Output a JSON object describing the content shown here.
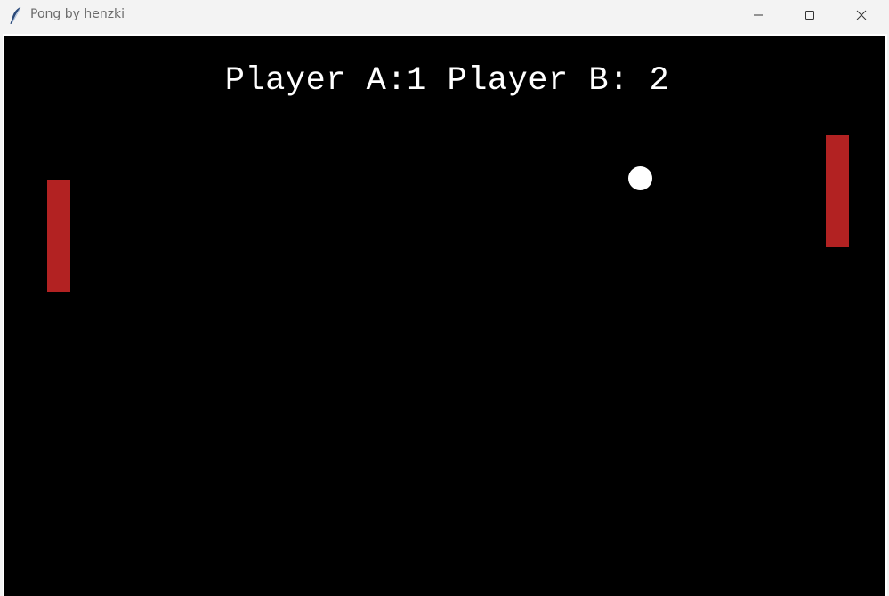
{
  "window": {
    "title": "Pong by henzki",
    "icon": "feather-icon",
    "controls": {
      "minimize": "minimize-icon",
      "maximize": "maximize-icon",
      "close": "close-icon"
    }
  },
  "game": {
    "score_text": "Player A:1 Player B: 2",
    "colors": {
      "background": "#000000",
      "paddle": "#b22222",
      "ball": "#ffffff",
      "text": "#ffffff"
    }
  }
}
